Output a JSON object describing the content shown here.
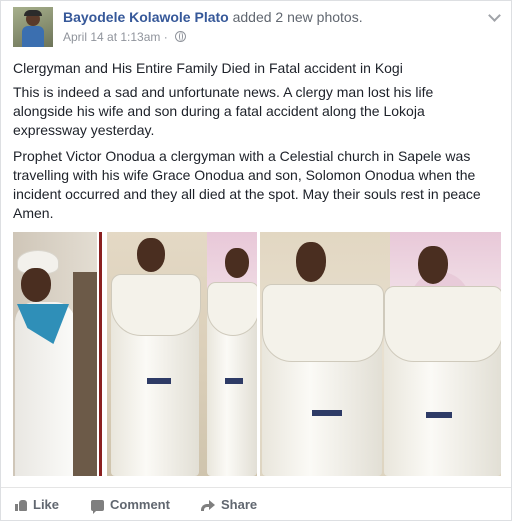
{
  "post": {
    "author": "Bayodele Kolawole Plato",
    "action": "added 2 new photos.",
    "timestamp": "April 14 at 1:13am",
    "separator": "·",
    "privacy_icon": "globe-icon",
    "menu_icon": "chevron-down-icon",
    "paragraphs": [
      "Clergyman and His Entire Family Died in Fatal accident in Kogi",
      "This is indeed a sad and unfortunate news. A clergy man lost his life alongside his wife and son during a fatal accident along the Lokoja expressway yesterday.",
      "Prophet Victor Onodua a clergyman with a Celestial church in Sapele was travelling with his wife Grace Onodua and son, Solomon Onodua when the incident occurred and they all died at the spot. May their souls rest in peace Amen."
    ]
  },
  "actions": {
    "like": "Like",
    "comment": "Comment",
    "share": "Share"
  },
  "colors": {
    "author_link": "#365899",
    "meta": "#90949c",
    "text": "#1d2129",
    "action_text": "#616770"
  }
}
